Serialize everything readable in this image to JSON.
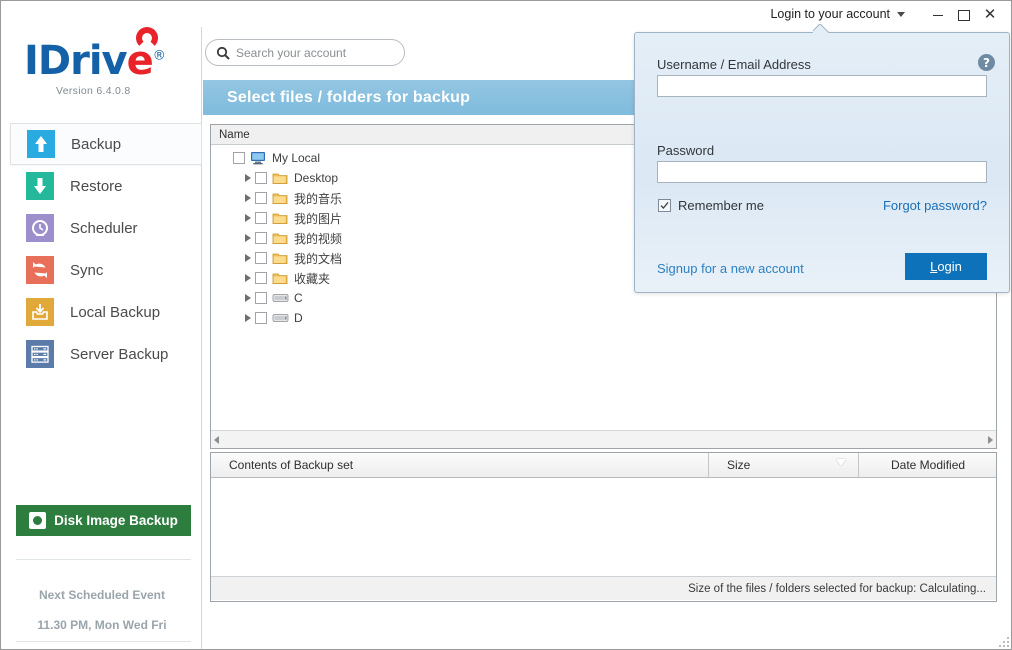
{
  "window": {
    "account_menu_label": "Login to your account",
    "minimize_label": "",
    "maximize_label": "",
    "close_label": "✕"
  },
  "brand": {
    "logo_part1": "IDriv",
    "logo_part2": "e",
    "registered": "®",
    "version": "Version  6.4.0.8"
  },
  "sidebar": {
    "items": [
      {
        "label": "Backup",
        "icon": "upload-arrow-icon",
        "color": "#29ABE2",
        "active": true
      },
      {
        "label": "Restore",
        "icon": "download-arrow-icon",
        "color": "#23B99A",
        "active": false
      },
      {
        "label": "Scheduler",
        "icon": "clock-icon",
        "color": "#9C8FCC",
        "active": false
      },
      {
        "label": "Sync",
        "icon": "sync-arrows-icon",
        "color": "#E8705A",
        "active": false
      },
      {
        "label": "Local Backup",
        "icon": "inbox-arrow-icon",
        "color": "#E0A93A",
        "active": false
      },
      {
        "label": "Server Backup",
        "icon": "server-rack-icon",
        "color": "#5B7CA8",
        "active": false
      }
    ],
    "disk_image_button": "Disk Image Backup",
    "schedule_title": "Next Scheduled Event",
    "schedule_time": "11.30 PM, Mon Wed Fri"
  },
  "search": {
    "placeholder": "Search your account",
    "value": ""
  },
  "main": {
    "banner_title": "Select files / folders for backup",
    "tree_header": "Name",
    "tree_rows": [
      {
        "label": "My Local",
        "icon": "computer-icon",
        "indent": 0,
        "expander": false,
        "checked": false
      },
      {
        "label": "Desktop",
        "icon": "folder-icon",
        "indent": 1,
        "expander": true,
        "checked": false
      },
      {
        "label": "我的音乐",
        "icon": "folder-icon",
        "indent": 1,
        "expander": true,
        "checked": false
      },
      {
        "label": "我的图片",
        "icon": "folder-icon",
        "indent": 1,
        "expander": true,
        "checked": false
      },
      {
        "label": "我的视频",
        "icon": "folder-icon",
        "indent": 1,
        "expander": true,
        "checked": false
      },
      {
        "label": "我的文档",
        "icon": "folder-icon",
        "indent": 1,
        "expander": true,
        "checked": false
      },
      {
        "label": "收藏夹",
        "icon": "folder-icon",
        "indent": 1,
        "expander": true,
        "checked": false
      },
      {
        "label": "C",
        "icon": "drive-icon",
        "indent": 1,
        "expander": true,
        "checked": false
      },
      {
        "label": "D",
        "icon": "drive-icon",
        "indent": 1,
        "expander": true,
        "checked": false
      }
    ],
    "contents_columns": {
      "name": "Contents of Backup set",
      "size": "Size",
      "date_modified": "Date Modified"
    },
    "contents_rows": [],
    "status_text": "Size of the files / folders selected for backup: Calculating..."
  },
  "login_panel": {
    "username_label": "Username / Email Address",
    "username_value": "",
    "password_label": "Password",
    "password_value": "",
    "remember_me_label": "Remember me",
    "remember_me_checked": true,
    "forgot_password_label": "Forgot password?",
    "signup_label": "Signup for a new account",
    "login_button_first": "L",
    "login_button_rest": "ogin",
    "help_glyph": "?"
  },
  "colors": {
    "accent_blue": "#0D72B9",
    "banner_blue": "#7FBBDD",
    "brand_blue": "#1461A8",
    "brand_red": "#E8232A",
    "green_button": "#2D7D3F"
  }
}
